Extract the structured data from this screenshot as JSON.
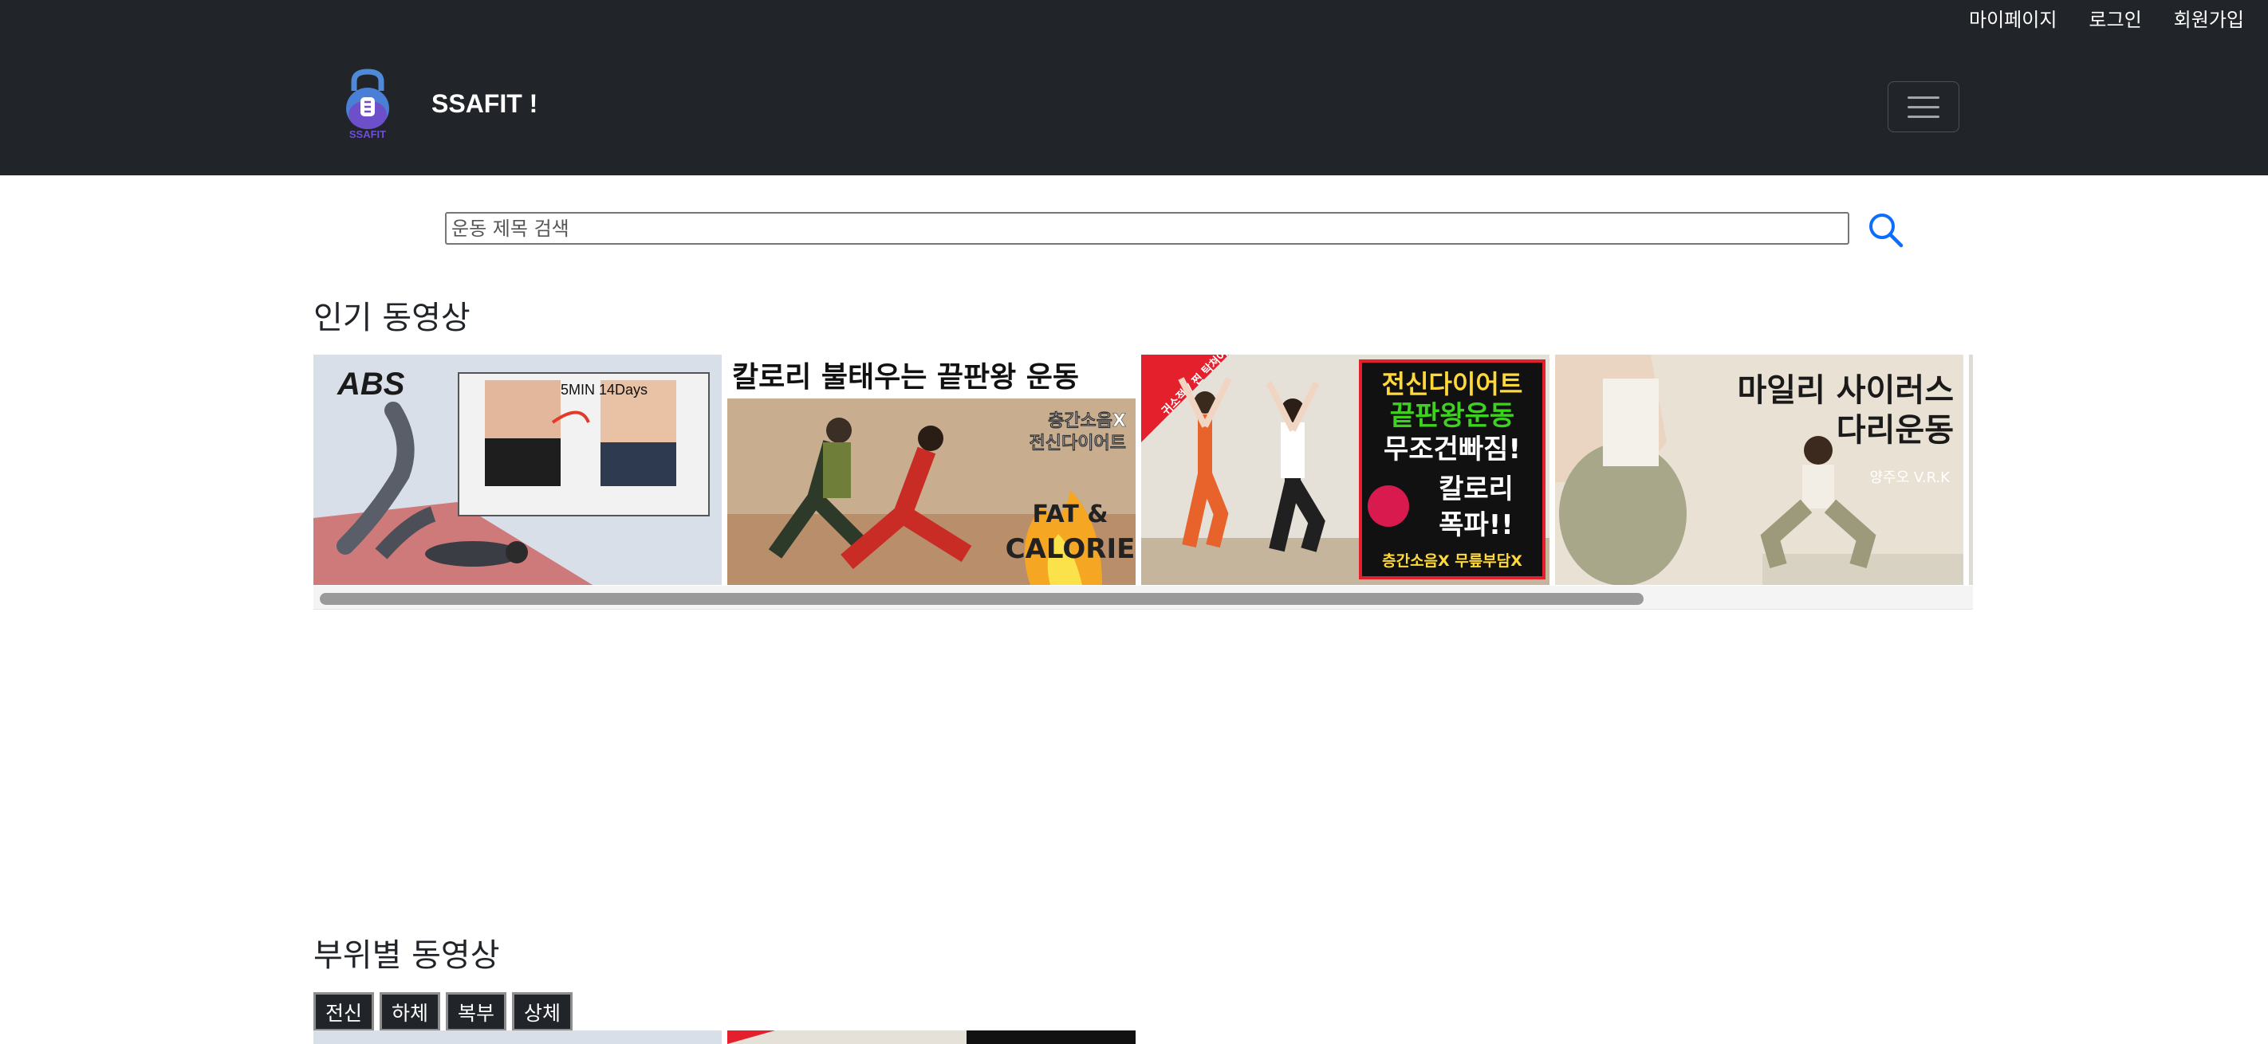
{
  "nav": {
    "links": [
      "마이페이지",
      "로그인",
      "회원가입"
    ],
    "logo_text": "SSAFIT",
    "brand": "SSAFIT !"
  },
  "search": {
    "placeholder": "운동 제목 검색",
    "value": ""
  },
  "popular": {
    "title": "인기 동영상",
    "videos": [
      {
        "badge": "ABS",
        "note": "5MIN 14Days"
      },
      {
        "title": "칼로리 불태우는 끝판왕 운동",
        "sub1": "층간소음X",
        "sub2": "전신다이어트",
        "fat1": "FAT &",
        "fat2": "CALORIE"
      },
      {
        "corner": "귀소적 / 찐 탁쳐여분엇",
        "l1": "전신다이어트",
        "l2": "끝판왕운동",
        "l3": "무조건빠짐!",
        "l4": "칼로리",
        "l5": "폭파!!",
        "l6": "층간소음X 무릎부담X"
      },
      {
        "l1": "마일리 사이러스",
        "l2": "다리운동",
        "tag": "양주오 V.R.K"
      }
    ]
  },
  "category": {
    "title": "부위별 동영상",
    "tabs": [
      "전신",
      "하체",
      "복부",
      "상체"
    ]
  },
  "colors": {
    "navbar": "#212529",
    "search_icon": "#0d6efd",
    "tab_bg": "#212529",
    "thumb_accent_red": "#e3202c",
    "thumb_accent_green": "#3cd21f",
    "thumb_accent_yellow": "#ffd83a"
  },
  "icons": {
    "search": "search-icon",
    "menu": "hamburger-icon",
    "logo": "kettlebell-logo-icon"
  }
}
